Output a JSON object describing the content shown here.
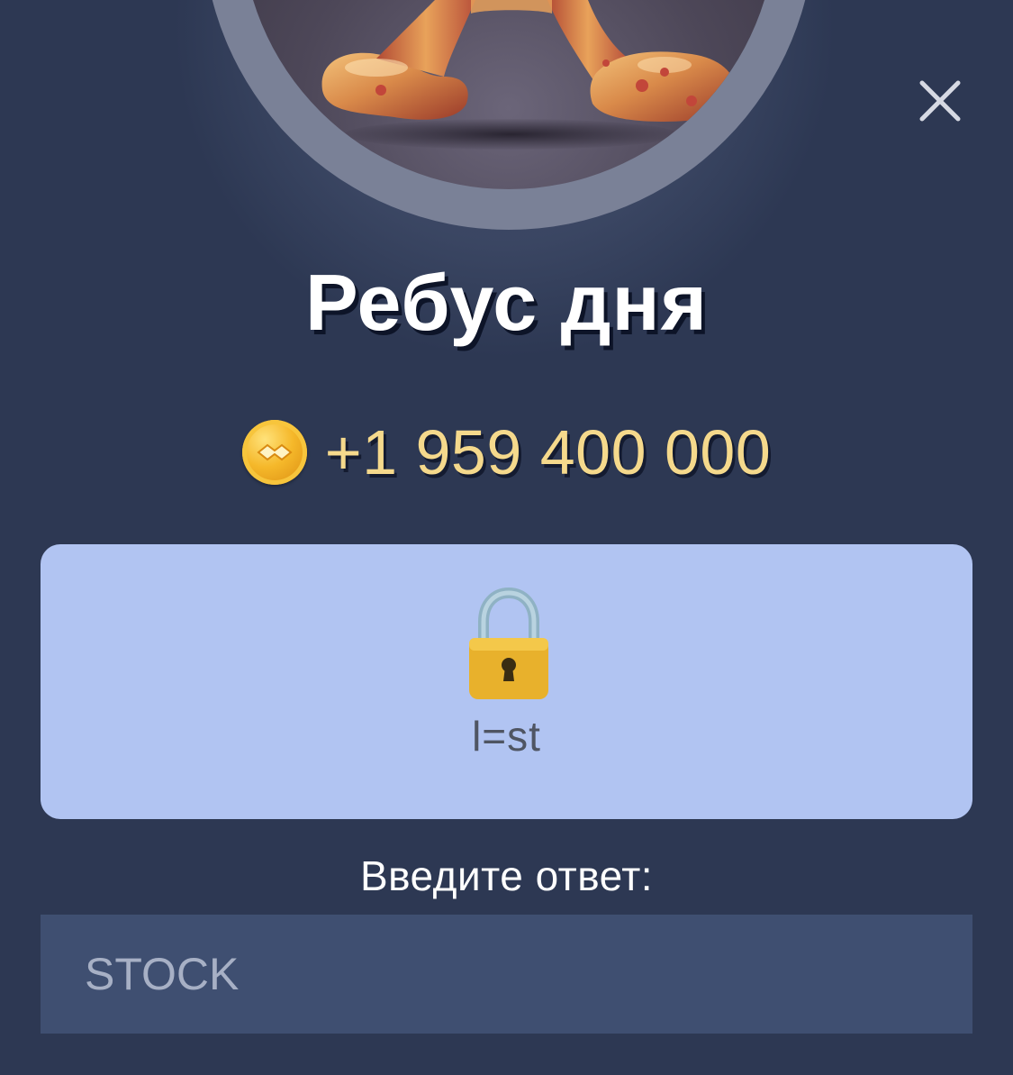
{
  "header": {
    "close_icon": "close-icon"
  },
  "puzzle": {
    "title": "Ребус дня",
    "reward": {
      "coin_icon": "coin-icon",
      "amount": "+1 959 400 000"
    },
    "rebus": {
      "lock_icon": "lock-icon",
      "hint": "l=st"
    }
  },
  "answer": {
    "label": "Введите ответ:",
    "placeholder": "STOCK"
  },
  "colors": {
    "background": "#2d3853",
    "card": "#b1c4f2",
    "input": "#3f4f71",
    "reward_text": "#f5d98c"
  }
}
